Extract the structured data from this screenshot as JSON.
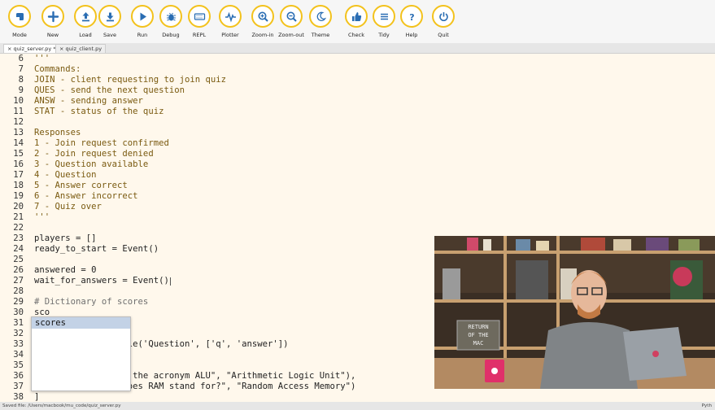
{
  "toolbar": {
    "buttons": [
      {
        "label": "Mode",
        "icon": "mode-icon"
      },
      {
        "label": "New",
        "icon": "plus-icon"
      },
      {
        "label": "Load",
        "icon": "upload-icon"
      },
      {
        "label": "Save",
        "icon": "download-icon"
      },
      {
        "label": "Run",
        "icon": "play-icon"
      },
      {
        "label": "Debug",
        "icon": "bug-icon"
      },
      {
        "label": "REPL",
        "icon": "keyboard-icon"
      },
      {
        "label": "Plotter",
        "icon": "pulse-icon"
      },
      {
        "label": "Zoom-in",
        "icon": "zoom-in-icon"
      },
      {
        "label": "Zoom-out",
        "icon": "zoom-out-icon"
      },
      {
        "label": "Theme",
        "icon": "moon-icon"
      },
      {
        "label": "Check",
        "icon": "thumbs-up-icon"
      },
      {
        "label": "Tidy",
        "icon": "menu-lines-icon"
      },
      {
        "label": "Help",
        "icon": "question-icon"
      },
      {
        "label": "Quit",
        "icon": "power-icon"
      }
    ]
  },
  "tabs": [
    {
      "label": "quiz_server.py *",
      "close": "×"
    },
    {
      "label": "quiz_client.py",
      "close": "×"
    }
  ],
  "editor": {
    "lines": [
      {
        "n": "6",
        "text": "'''",
        "cls": "c-str"
      },
      {
        "n": "7",
        "text": "Commands:",
        "cls": "c-str"
      },
      {
        "n": "8",
        "text": "JOIN - client requesting to join quiz",
        "cls": "c-str"
      },
      {
        "n": "9",
        "text": "QUES - send the next question",
        "cls": "c-str"
      },
      {
        "n": "10",
        "text": "ANSW - sending answer",
        "cls": "c-str"
      },
      {
        "n": "11",
        "text": "STAT - status of the quiz",
        "cls": "c-str"
      },
      {
        "n": "12",
        "text": "",
        "cls": "c-str"
      },
      {
        "n": "13",
        "text": "Responses",
        "cls": "c-str"
      },
      {
        "n": "14",
        "text": "1 - Join request confirmed",
        "cls": "c-str"
      },
      {
        "n": "15",
        "text": "2 - Join request denied",
        "cls": "c-str"
      },
      {
        "n": "16",
        "text": "3 - Question available",
        "cls": "c-str"
      },
      {
        "n": "17",
        "text": "4 - Question",
        "cls": "c-str"
      },
      {
        "n": "18",
        "text": "5 - Answer correct",
        "cls": "c-str"
      },
      {
        "n": "19",
        "text": "6 - Answer incorrect",
        "cls": "c-str"
      },
      {
        "n": "20",
        "text": "7 - Quiz over",
        "cls": "c-str"
      },
      {
        "n": "21",
        "text": "'''",
        "cls": "c-str"
      },
      {
        "n": "22",
        "text": "",
        "cls": "c-def"
      },
      {
        "n": "23",
        "text": "players = []",
        "cls": "c-def"
      },
      {
        "n": "24",
        "text": "ready_to_start = Event()",
        "cls": "c-def"
      },
      {
        "n": "25",
        "text": "",
        "cls": "c-def"
      },
      {
        "n": "26",
        "text": "answered = 0",
        "cls": "c-def"
      },
      {
        "n": "27",
        "text": "wait_for_answers = Event()",
        "cls": "c-def"
      },
      {
        "n": "28",
        "text": "",
        "cls": "c-def"
      },
      {
        "n": "29",
        "text": "# Dictionary of scores",
        "cls": "c-cmt"
      },
      {
        "n": "30",
        "text": "sco",
        "cls": "c-def"
      },
      {
        "n": "31",
        "text": "",
        "cls": "c-def"
      },
      {
        "n": "32",
        "text": "",
        "cls": "c-def"
      },
      {
        "n": "33",
        "text": "                  le('Question', ['q', 'answer'])",
        "cls": "c-def"
      },
      {
        "n": "34",
        "text": "",
        "cls": "c-def"
      },
      {
        "n": "35",
        "text": "",
        "cls": "c-def"
      },
      {
        "n": "36",
        "text": "                 d the acronym ALU\", \"Arithmetic Logic Unit\"),",
        "cls": "c-def"
      },
      {
        "n": "37",
        "text": "                 does RAM stand for?\", \"Random Access Memory\")",
        "cls": "c-def"
      },
      {
        "n": "38",
        "text": "]",
        "cls": "c-def"
      }
    ]
  },
  "autocomplete": {
    "items": [
      "scores"
    ]
  },
  "status": {
    "text": "Saved file: /Users/macbook/mu_code/quiz_server.py",
    "right": "Pyth"
  },
  "video": {
    "sign_text": "RETURN OF THE MAC"
  }
}
